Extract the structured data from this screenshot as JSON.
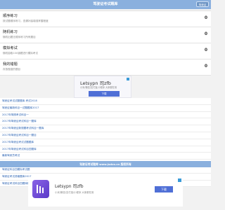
{
  "header": {
    "title": "驾驶证考试题库",
    "button_label": "驾驶证"
  },
  "menu": [
    {
      "title": "顺序练习",
      "desc": "按试题顺序练习，查漏补缺增强掌握程度",
      "count": "0"
    },
    {
      "title": "随机练习",
      "desc": "随机出题无顺序练习所有题目",
      "count": "0"
    },
    {
      "title": "模拟考试",
      "desc": "随机抽取100道题进行模拟考试",
      "count": "0"
    },
    {
      "title": "我的错题",
      "desc": "存放做错的题目",
      "count": "0"
    }
  ],
  "ad_top": {
    "title": "Letsypn 司zfb",
    "subtitle": "小米/微信/支付宝/小程序 大家都在用",
    "button": "下载"
  },
  "links": [
    "驾驶证考试试题题库 考试2018",
    "驾驶证最新科目一试题题库2017",
    "2017年驾照考试科目一",
    "2017年驾驶证考试科目一题库",
    "2017年驾驶证新规题考试科目一题库",
    "2017年驾驶证考试科目一题目",
    "2017年驾驶证考试试题题库",
    "2017年驾驶证考试科目四题库",
    "最新驾驶员考试",
    "驾驶证科目四如何考题库？",
    "驾驶证科目四模拟考试题",
    "驾驶证考试资格题库2017",
    "驾驶证考试科目四题库题目"
  ],
  "footer": {
    "text": "驾驶证考试题库 www.jsdxs.cn 版权所有"
  },
  "ad_bottom": {
    "title": "Letsypn 司zfb",
    "subtitle": "小米/微信/支付宝/小程序 大家都在用",
    "button": "下载"
  }
}
